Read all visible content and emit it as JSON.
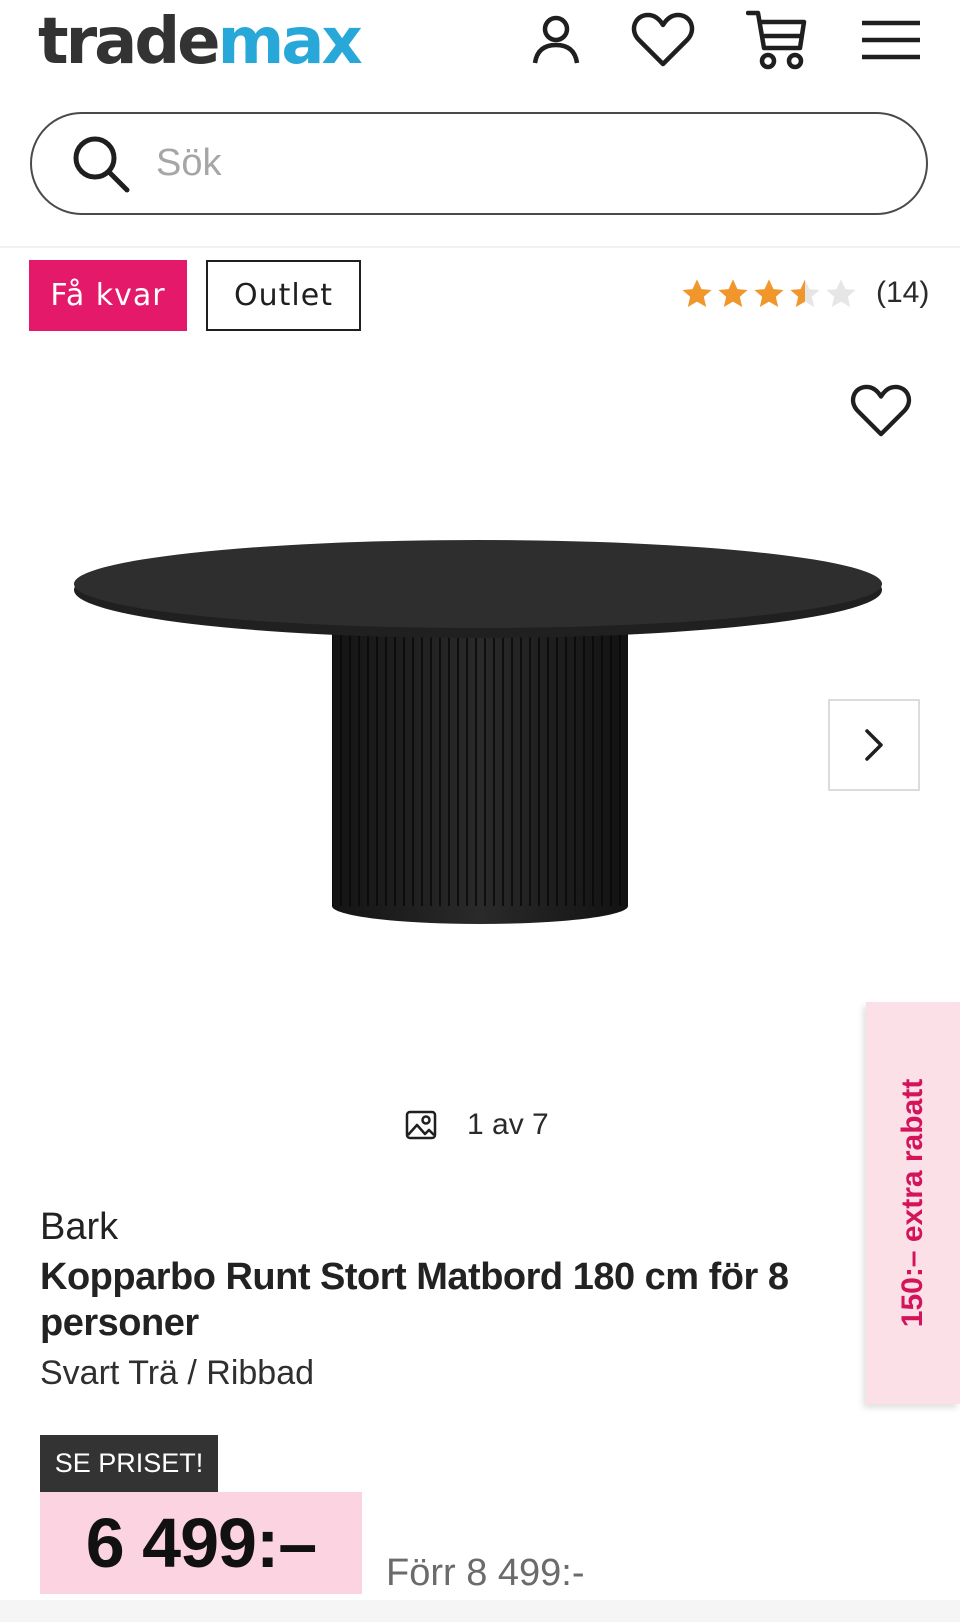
{
  "header": {
    "logo_part1": "trade",
    "logo_part2": "max",
    "icons": [
      "user-icon",
      "heart-icon",
      "cart-icon",
      "menu-icon"
    ]
  },
  "search": {
    "placeholder": "Sök"
  },
  "badges": {
    "few_left": "Få kvar",
    "outlet": "Outlet"
  },
  "rating": {
    "value": 3.5,
    "max": 5,
    "count_label": "(14)"
  },
  "gallery": {
    "counter": "1 av 7",
    "current": 1,
    "total": 7
  },
  "promo": {
    "side_tab": "150:– extra rabatt"
  },
  "product": {
    "brand": "Bark",
    "title": "Kopparbo Runt Stort Matbord 180 cm för 8 personer",
    "variant": "Svart Trä / Ribbad"
  },
  "pricing": {
    "tag": "SE PRISET!",
    "price": "6 499:–",
    "old_price": "Förr 8 499:-"
  },
  "colors": {
    "brand_blue": "#27a8d8",
    "logo_dark": "#333333",
    "accent_pink": "#e4196a",
    "price_bg": "#fbd3e1",
    "star": "#f0962b"
  }
}
